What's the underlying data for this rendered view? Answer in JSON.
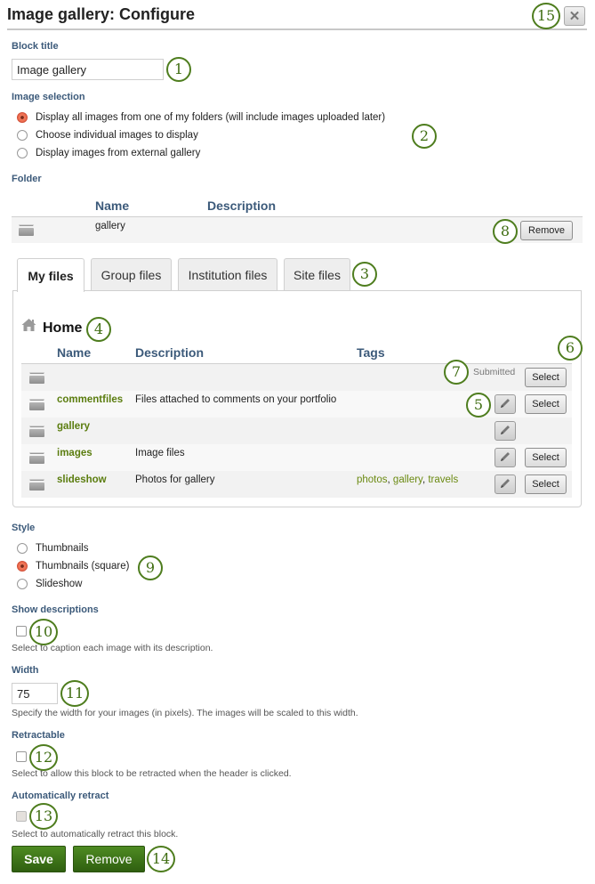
{
  "header": {
    "title": "Image gallery: Configure",
    "close_icon": "close-x-icon"
  },
  "block_title": {
    "label": "Block title",
    "value": "Image gallery"
  },
  "image_selection": {
    "label": "Image selection",
    "options": [
      {
        "label": "Display all images from one of my folders (will include images uploaded later)",
        "selected": true
      },
      {
        "label": "Choose individual images to display",
        "selected": false
      },
      {
        "label": "Display images from external gallery",
        "selected": false
      }
    ]
  },
  "folder": {
    "label": "Folder",
    "columns": [
      "Name",
      "Description"
    ],
    "selected_row": {
      "name": "gallery",
      "description": "",
      "remove_label": "Remove"
    }
  },
  "file_tabs": {
    "tabs": [
      {
        "label": "My files",
        "active": true
      },
      {
        "label": "Group files",
        "active": false
      },
      {
        "label": "Institution files",
        "active": false
      },
      {
        "label": "Site files",
        "active": false
      }
    ]
  },
  "browser": {
    "breadcrumb": "Home",
    "columns": [
      "Name",
      "Description",
      "Tags"
    ],
    "select_label": "Select",
    "submitted_label": "Submitted",
    "rows": [
      {
        "name": "",
        "description": "",
        "tags": [],
        "status": "Submitted",
        "editable": false,
        "selectable": true
      },
      {
        "name": "commentfiles",
        "description": "Files attached to comments on your portfolio",
        "tags": [],
        "editable": true,
        "selectable": true
      },
      {
        "name": "gallery",
        "description": "",
        "tags": [],
        "editable": true,
        "selectable": false
      },
      {
        "name": "images",
        "description": "Image files",
        "tags": [],
        "editable": true,
        "selectable": true
      },
      {
        "name": "slideshow",
        "description": "Photos for gallery",
        "tags": [
          "photos",
          "gallery",
          "travels"
        ],
        "editable": true,
        "selectable": true
      }
    ]
  },
  "style": {
    "label": "Style",
    "options": [
      {
        "label": "Thumbnails",
        "selected": false
      },
      {
        "label": "Thumbnails (square)",
        "selected": true
      },
      {
        "label": "Slideshow",
        "selected": false
      }
    ]
  },
  "show_descriptions": {
    "label": "Show descriptions",
    "checked": false,
    "hint": "Select to caption each image with its description."
  },
  "width": {
    "label": "Width",
    "value": "75",
    "hint": "Specify the width for your images (in pixels). The images will be scaled to this width."
  },
  "retractable": {
    "label": "Retractable",
    "checked": false,
    "hint": "Select to allow this block to be retracted when the header is clicked."
  },
  "auto_retract": {
    "label": "Automatically retract",
    "checked": false,
    "disabled": true,
    "hint": "Select to automatically retract this block."
  },
  "actions": {
    "save_label": "Save",
    "remove_label": "Remove"
  },
  "callouts": [
    "1",
    "2",
    "3",
    "4",
    "5",
    "6",
    "7",
    "8",
    "9",
    "10",
    "11",
    "12",
    "13",
    "14",
    "15"
  ],
  "colors": {
    "label_blue": "#3c5a7a",
    "link_green": "#5b7d0f",
    "button_green": "#3d7418",
    "radio_selected": "#e85c40",
    "callout_green": "#4e7d1e"
  }
}
